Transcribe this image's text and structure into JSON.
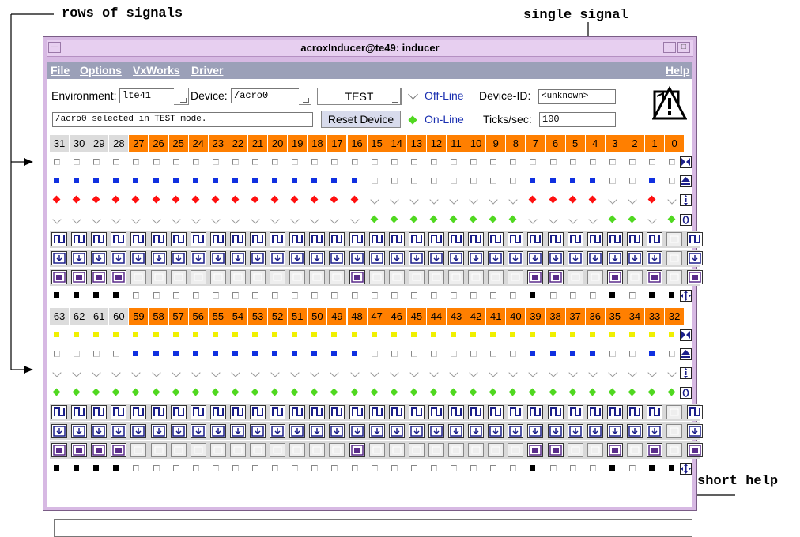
{
  "annotations": {
    "rows_of_signals": "rows of signals",
    "single_signal": "single signal",
    "short_help": "short help"
  },
  "window": {
    "title": "acroxInducer@te49: inducer"
  },
  "menu": {
    "file": "File",
    "options": "Options",
    "vxworks": "VxWorks",
    "driver": "Driver",
    "help": "Help"
  },
  "controls": {
    "environment_label": "Environment:",
    "environment_value": "lte41",
    "device_label": "Device:",
    "device_value": "/acro0",
    "mode_value": "TEST",
    "offline_label": "Off-Line",
    "online_label": "On-Line",
    "device_id_label": "Device-ID:",
    "device_id_value": "<unknown>",
    "ticks_label": "Ticks/sec:",
    "ticks_value": "100",
    "status_message": "/acro0 selected in TEST mode.",
    "reset_button": "Reset Device",
    "device_icon": "warning-device-icon"
  },
  "colors": {
    "active_header": "#ff7f00",
    "inactive_header": "#dcdcdc",
    "red": "#ff1010",
    "green": "#50d820",
    "blue": "#1030e0",
    "yellow": "#f0f000",
    "window_frame": "#d7b9e3",
    "menubar": "#9ba0b8"
  },
  "groups": [
    {
      "labels": [
        "31",
        "30",
        "29",
        "28",
        "27",
        "26",
        "25",
        "24",
        "23",
        "22",
        "21",
        "20",
        "19",
        "18",
        "17",
        "16",
        "15",
        "14",
        "13",
        "12",
        "11",
        "10",
        "9",
        "8",
        "7",
        "6",
        "5",
        "4",
        "3",
        "2",
        "1",
        "0"
      ],
      "header_active": "00001111111111111111111111111111",
      "rows": [
        {
          "type": "mark",
          "codes": "CCCCCCCCCCCCCCCCCCCCCCCCCCCCCCCC",
          "control": "down-up-icon"
        },
        {
          "type": "mark",
          "codes": "BBBBBBBBBBBBBBBBCCCCCCCCBBBBCCBC",
          "control": "triangle-up-icon"
        },
        {
          "type": "mark",
          "codes": "RRRRRRRRRRRRRRRRVVVVVVVVRRRRVVRV",
          "control": "info-icon"
        },
        {
          "type": "mark",
          "codes": "VVVVVVVVVVVVVVVVGGGGGGGGVVVVGGVG",
          "control": "zero-icon"
        },
        {
          "type": "btn",
          "glyph": "pulse",
          "active": "11111111111111111111111111111110"
        },
        {
          "type": "btn",
          "glyph": "arrow",
          "active": "11111111111111111111111111111110"
        },
        {
          "type": "btn",
          "glyph": "square",
          "active": "11110000000000010000000011001010"
        },
        {
          "type": "mark",
          "codes": "KKKKCCCCCCCCCCCCCCCCCCCCKCCCKCKKK",
          "control": "move-icon"
        }
      ]
    },
    {
      "labels": [
        "63",
        "62",
        "61",
        "60",
        "59",
        "58",
        "57",
        "56",
        "55",
        "54",
        "53",
        "52",
        "51",
        "50",
        "49",
        "48",
        "47",
        "46",
        "45",
        "44",
        "43",
        "42",
        "41",
        "40",
        "39",
        "38",
        "37",
        "36",
        "35",
        "34",
        "33",
        "32"
      ],
      "header_active": "00001111111111111111111111111111",
      "rows": [
        {
          "type": "mark",
          "codes": "YYYYYYYYYYYYYYYYYYYYYYYYYYYYYYYY",
          "control": "down-up-icon"
        },
        {
          "type": "mark",
          "codes": "CCCCBBBBBBBBBBBBCCCCCCCCBBBBCCBC",
          "control": "triangle-up-icon"
        },
        {
          "type": "mark",
          "codes": "VVVVVVVVVVVVVVVVVVVVVVVVVVVVVVVV",
          "control": "info-icon"
        },
        {
          "type": "mark",
          "codes": "GGGGGGGGGGGGGGGGGGGGGGGGGGGGGGGG",
          "control": "zero-icon"
        },
        {
          "type": "btn",
          "glyph": "pulse",
          "active": "11111111111111111111111111111110"
        },
        {
          "type": "btn",
          "glyph": "arrow",
          "active": "11111111111111111111111111111110"
        },
        {
          "type": "btn",
          "glyph": "square",
          "active": "11110000000000010000000011001010"
        },
        {
          "type": "mark",
          "codes": "KKKKCCCCCCCCCCCCCCCCCCCCKCCCKCKKK",
          "control": "move-icon"
        }
      ]
    }
  ],
  "short_help_text": ""
}
